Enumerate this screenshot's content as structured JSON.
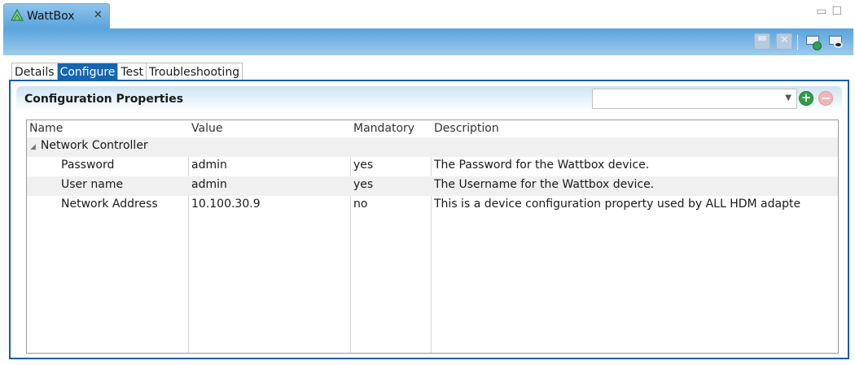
{
  "view_tab": {
    "title": "WattBox",
    "close_glyph": "✕"
  },
  "window_controls": {
    "minimize": "▭",
    "maximize": "☐"
  },
  "toolbar": {
    "buttons": [
      "save-icon",
      "revert-icon",
      "configure-device-icon",
      "view-device-icon"
    ]
  },
  "subtabs": [
    "Details",
    "Configure",
    "Test",
    "Troubleshooting"
  ],
  "active_subtab": "Configure",
  "section": {
    "title": "Configuration Properties",
    "combo_value": "",
    "combo_arrow": "▼"
  },
  "table": {
    "columns": [
      "Name",
      "Value",
      "Mandatory",
      "Description"
    ],
    "group": {
      "expander": "◢",
      "label": "Network Controller"
    },
    "rows": [
      {
        "name": "Password",
        "value": "admin",
        "mandatory": "yes",
        "description": "The Password for the Wattbox device."
      },
      {
        "name": "User name",
        "value": "admin",
        "mandatory": "yes",
        "description": "The Username for the Wattbox device."
      },
      {
        "name": "Network Address",
        "value": "10.100.30.9",
        "mandatory": "no",
        "description": "This is a device configuration property used by ALL HDM adapte"
      }
    ]
  },
  "colors": {
    "accent": "#1665b0",
    "panel_border": "#1a5ea6",
    "add": "#2ea043",
    "remove": "#f2b6b6"
  }
}
